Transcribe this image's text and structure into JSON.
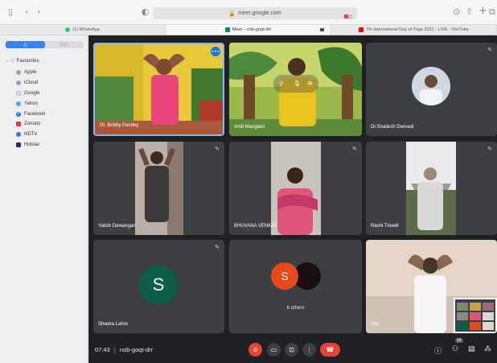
{
  "browser": {
    "url": "meet.google.com",
    "lock_icon": "lock-icon",
    "tabs": [
      {
        "label": "(1) WhatsApp",
        "color": "#25d366"
      },
      {
        "label": "Meet – nob-goqt-drr",
        "color": "#00897b"
      },
      {
        "label": "7th International Day of Yoga 2021 - LIVE - YouTube",
        "color": "#ff0000"
      }
    ]
  },
  "sidebar": {
    "header": "Favourites",
    "items": [
      {
        "label": "Apple",
        "icon": "apple-icon",
        "color": "#9aa0a6"
      },
      {
        "label": "iCloud",
        "icon": "apple-icon",
        "color": "#9aa0a6"
      },
      {
        "label": "Google",
        "icon": "google-icon",
        "color": "#4285f4"
      },
      {
        "label": "Yahoo",
        "icon": "yahoo-icon",
        "color": "#4da3ff"
      },
      {
        "label": "Facebook",
        "icon": "facebook-icon",
        "color": "#1877f2"
      },
      {
        "label": "Zomato",
        "icon": "zomato-icon",
        "color": "#e23744"
      },
      {
        "label": "NDTV",
        "icon": "ndtv-icon",
        "color": "#3b6fd6"
      },
      {
        "label": "Hotstar",
        "icon": "hotstar-icon",
        "color": "#1f2b6b"
      }
    ]
  },
  "participants": [
    {
      "name": "Dr. Bobby Pandey"
    },
    {
      "name": "Amit Manglani"
    },
    {
      "name": "Dr.Shailesh Dwivedi"
    },
    {
      "name": "Yatish Dewangan"
    },
    {
      "name": "BHUVANA VENKAT"
    },
    {
      "name": "Rashi Trivedi"
    },
    {
      "name": "Shweta Lahre",
      "initial": "S",
      "avatar_color": "#0b5e47"
    },
    {
      "name": "6 others",
      "initial": "S",
      "avatar_color": "#e64a19"
    },
    {
      "name": "You"
    }
  ],
  "meeting": {
    "time": "07:43",
    "separator": "|",
    "code": "nob-goqt-drr",
    "participant_count": "14"
  }
}
